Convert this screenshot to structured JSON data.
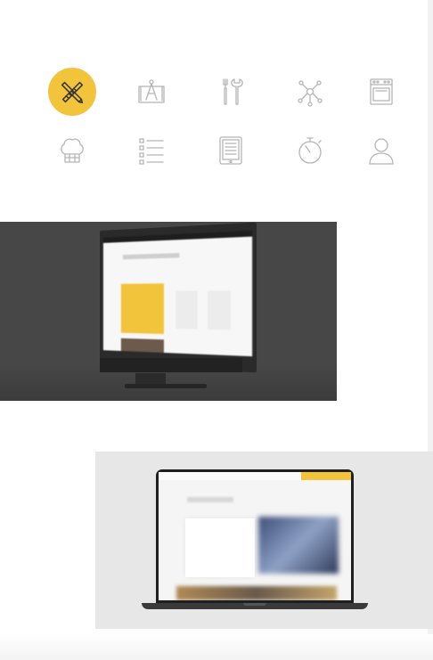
{
  "colors": {
    "accent": "#f2c43c",
    "icon_stroke": "#b5b5b5",
    "dark_backdrop": "#474747",
    "light_backdrop": "#e7e7e7"
  },
  "icons": [
    {
      "name": "pencil-ruler-icon",
      "active": true
    },
    {
      "name": "compass-blueprint-icon",
      "active": false
    },
    {
      "name": "tools-icon",
      "active": false
    },
    {
      "name": "network-icon",
      "active": false
    },
    {
      "name": "oven-icon",
      "active": false
    },
    {
      "name": "chef-hat-icon",
      "active": false
    },
    {
      "name": "checklist-icon",
      "active": false
    },
    {
      "name": "tablet-icon",
      "active": false
    },
    {
      "name": "stopwatch-icon",
      "active": false
    },
    {
      "name": "user-icon",
      "active": false
    }
  ]
}
